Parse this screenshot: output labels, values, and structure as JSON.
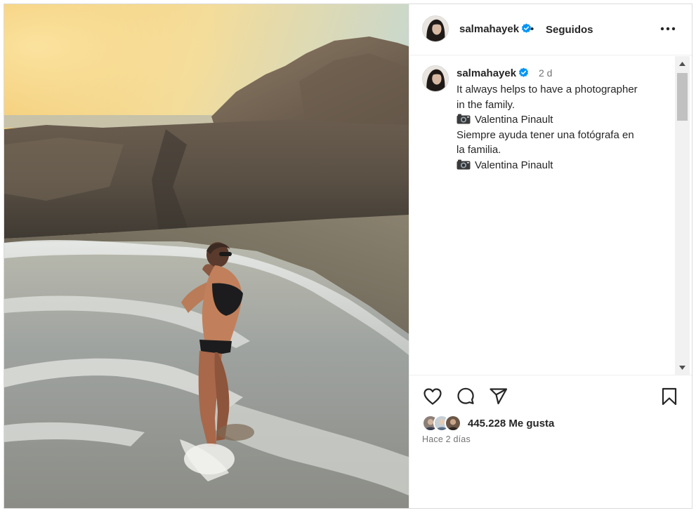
{
  "post": {
    "username": "salmahayek",
    "follow_status": "Seguidos",
    "separator": "•",
    "caption": {
      "username": "salmahayek",
      "time": "2 d",
      "line1": "It always helps to have a photographer",
      "line2": "in the family.",
      "credit1": "Valentina Pinault",
      "line4": "Siempre ayuda tener una fotógrafa en",
      "line5": "la familia.",
      "credit2": "Valentina Pinault"
    },
    "likes": "445.228 Me gusta",
    "time_ago": "Hace 2 días"
  },
  "icons": {
    "verified": "verified-badge-icon",
    "more": "more-options-icon",
    "camera": "camera-emoji-icon",
    "like": "heart-icon",
    "comment": "comment-icon",
    "share": "send-icon",
    "save": "bookmark-icon"
  },
  "colors": {
    "verified_blue": "#0095f6",
    "text_primary": "#262626",
    "text_secondary": "#737373",
    "border": "#dbdbdb"
  }
}
